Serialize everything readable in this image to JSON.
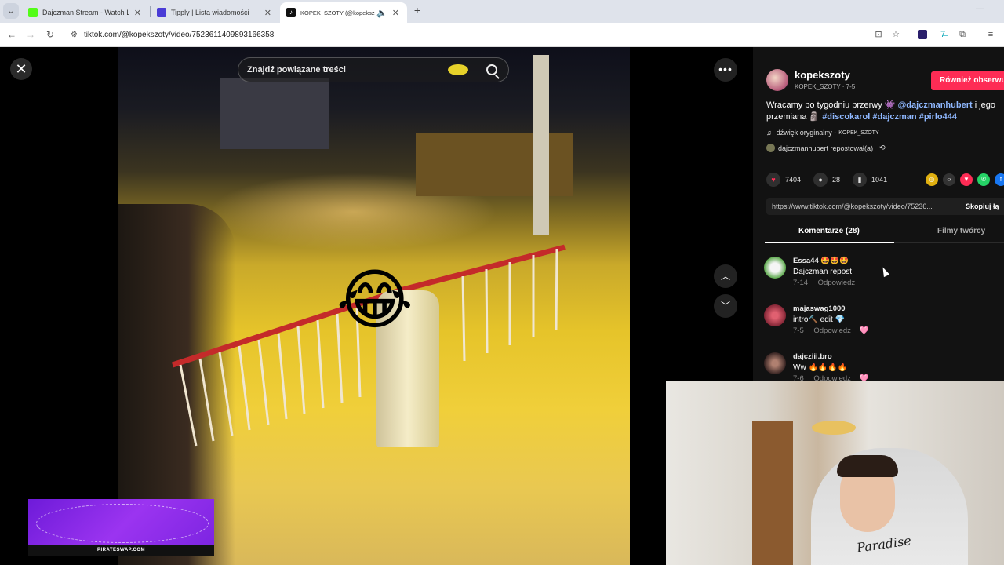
{
  "browser": {
    "tabs": [
      {
        "title": "Dajczman Stream - Watch Live",
        "favicon_color": "#53fc18"
      },
      {
        "title": "Tipply | Lista wiadomości",
        "favicon_color": "#4a3cd6"
      },
      {
        "title": "KOPEK_SZOTY (@kopekszoty)",
        "favicon_color": "#111111"
      }
    ],
    "url": "tiktok.com/@kopekszoty/video/7523611409893166358"
  },
  "player": {
    "search_placeholder": "Znajdź powiązane treści",
    "emoji": "😂"
  },
  "panel": {
    "username": "kopekszoty",
    "user_sub": "KOPEK_SZOTY · 7-5",
    "follow_label": "Również obserwuj",
    "desc_text": "Wracamy po tygodniu przerwy",
    "desc_mention": "@dajczmanhubert",
    "desc_text2": "i jego",
    "desc_text3": "przemiana",
    "hashtags": [
      "#discokarol",
      "#dajczman",
      "#pirlo444"
    ],
    "music": "dźwięk oryginalny -",
    "music_author": "KOPEK_SZOTY",
    "repost": "dajczmanhubert repostował(a)",
    "likes": "7404",
    "comments_count": "28",
    "saves": "1041",
    "share_link": "https://www.tiktok.com/@kopekszoty/video/75236...",
    "copy_label": "Skopiuj łą",
    "tab_comments": "Komentarze (28)",
    "tab_creator": "Filmy twórcy",
    "comments": [
      {
        "name": "Essa44 🤩🤩🤩",
        "text": "Dajczman repost",
        "date": "7-14",
        "reply": "Odpowiedz",
        "avatar_color": "#5aa84a"
      },
      {
        "name": "majaswag1000",
        "text": "intro⛏️ edit 💎",
        "date": "7-5",
        "reply": "Odpowiedz",
        "avatar_color": "#b03a4a"
      },
      {
        "name": "dajcziii.bro",
        "text": "Ww 🔥🔥🔥🔥",
        "date": "7-6",
        "reply": "Odpowiedz",
        "avatar_color": "#5a3a3a"
      }
    ]
  },
  "stream": {
    "hoodie_text": "Paradise",
    "ad_text": "PIRATESWAP.COM"
  }
}
